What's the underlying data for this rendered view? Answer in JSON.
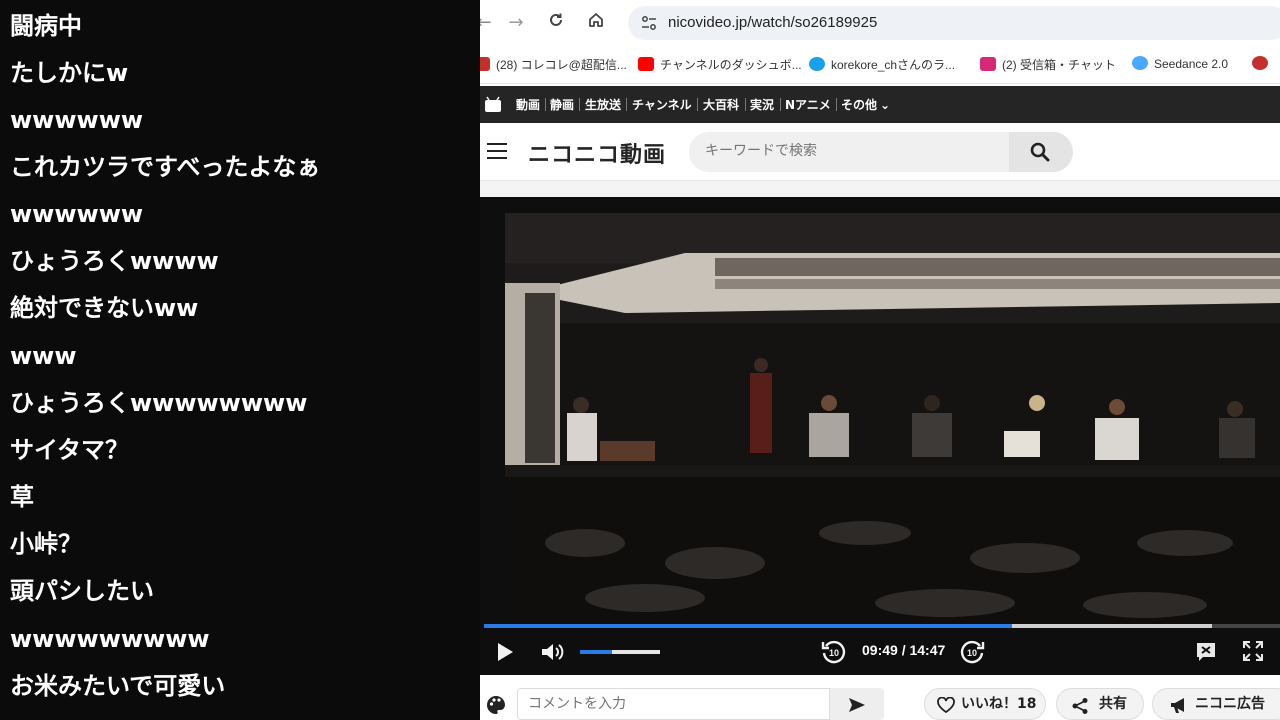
{
  "comments": [
    "闘病中",
    "たしかにw",
    "wwwwww",
    "これカツラですべったよなぁ",
    "wwwwww",
    "ひょうろくwwww",
    "絶対できないww",
    "www",
    "ひょうろくwwwwwwww",
    "サイタマ？",
    "草",
    "小峠？",
    "頭パシしたい",
    "wwwwwwwww",
    "お米みたいで可愛い"
  ],
  "browser": {
    "url": "nicovideo.jp/watch/so26189925",
    "bookmarks": [
      {
        "label": "(28) コレコレ@超配信...",
        "color": "#c4302b"
      },
      {
        "label": "チャンネルのダッシュボ...",
        "color": "#ff0000"
      },
      {
        "label": "korekore_chさんのラ...",
        "color": "#1aa0e8"
      },
      {
        "label": "(2) 受信箱・チャット",
        "color": "#d62976"
      },
      {
        "label": "Seedance 2.0",
        "color": "#4aa8ff"
      }
    ]
  },
  "niconico": {
    "nav": [
      "動画",
      "静画",
      "生放送",
      "チャンネル",
      "大百科",
      "実況",
      "Nアニメ",
      "その他"
    ],
    "logo": "ニコニコ動画",
    "search_placeholder": "キーワードで検索"
  },
  "player": {
    "current_time": "09:49",
    "duration": "14:47",
    "time_display": "09:49 / 14:47",
    "progress_fraction": 0.6637,
    "buffered_fraction": 0.915,
    "volume_fraction": 0.4,
    "accent": "#2a7be4"
  },
  "comment_bar": {
    "placeholder": "コメントを入力",
    "like_label": "いいね！",
    "like_count": "18",
    "share_label": "共有",
    "ad_label": "ニコニ広告"
  }
}
